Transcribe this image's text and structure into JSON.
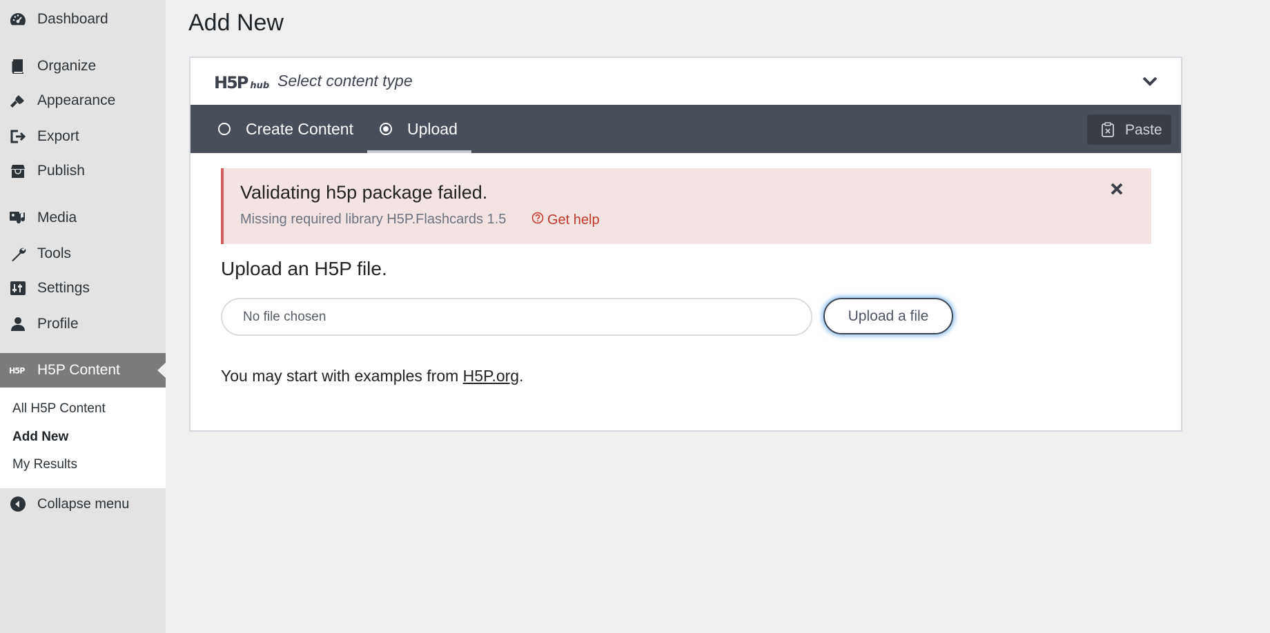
{
  "sidebar": {
    "items": [
      {
        "label": "Dashboard",
        "icon": "dashboard-icon"
      },
      {
        "label": "Organize",
        "icon": "book-icon"
      },
      {
        "label": "Appearance",
        "icon": "paintbrush-icon"
      },
      {
        "label": "Export",
        "icon": "export-icon"
      },
      {
        "label": "Publish",
        "icon": "store-icon"
      },
      {
        "label": "Media",
        "icon": "media-icon"
      },
      {
        "label": "Tools",
        "icon": "wrench-icon"
      },
      {
        "label": "Settings",
        "icon": "settings-icon"
      },
      {
        "label": "Profile",
        "icon": "user-icon"
      },
      {
        "label": "H5P Content",
        "icon": "h5p-icon"
      }
    ],
    "submenu": [
      "All H5P Content",
      "Add New",
      "My Results"
    ],
    "collapse_label": "Collapse menu"
  },
  "page": {
    "title": "Add New"
  },
  "hub": {
    "logo_text": "H5P",
    "logo_sub": "hub",
    "select_label": "Select content type",
    "tabs": [
      {
        "label": "Create Content",
        "selected": false
      },
      {
        "label": "Upload",
        "selected": true
      }
    ],
    "paste_label": "Paste"
  },
  "alert": {
    "title": "Validating h5p package failed.",
    "message": "Missing required library H5P.Flashcards 1.5",
    "help_label": "Get help"
  },
  "upload": {
    "heading": "Upload an H5P file.",
    "file_placeholder": "No file chosen",
    "button_label": "Upload a file",
    "examples_prefix": "You may start with examples from",
    "examples_link": "H5P.org",
    "examples_suffix": "."
  },
  "colors": {
    "sidebar_bg": "#e3e3e3",
    "active_item_bg": "#7b7b7b",
    "tabbar_bg": "#484f5a",
    "alert_bg": "#f3e3e3",
    "alert_border": "#d45d5d",
    "help_link": "#c0392b"
  }
}
